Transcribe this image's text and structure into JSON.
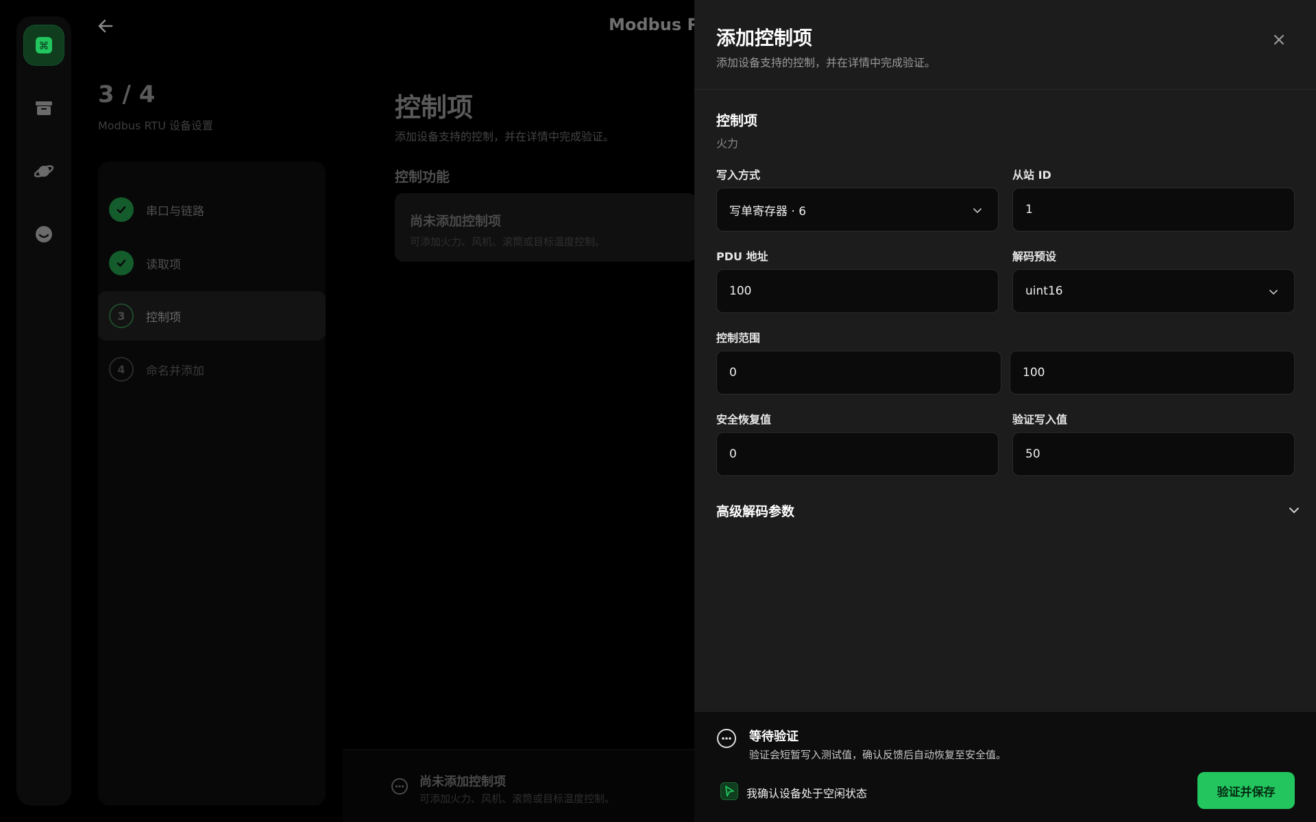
{
  "background": {
    "title": "Modbus R",
    "step_counter": "3 / 4",
    "step_subtitle": "Modbus RTU 设备设置",
    "steps": [
      {
        "label": "串口与链路",
        "state": "done"
      },
      {
        "label": "读取项",
        "state": "done"
      },
      {
        "label": "控制项",
        "state": "current",
        "number": "3"
      },
      {
        "label": "命名并添加",
        "state": "pending",
        "number": "4"
      }
    ],
    "heading": "控制项",
    "subheading": "添加设备支持的控制，并在详情中完成验证。",
    "section_title": "控制功能",
    "empty_card": {
      "title": "尚未添加控制项",
      "subtitle": "可添加火力、风机、滚筒或目标温度控制。"
    },
    "bottom": {
      "title": "尚未添加控制项",
      "subtitle": "可添加火力、风机、滚筒或目标温度控制。"
    }
  },
  "rail": {
    "items": [
      "command-icon",
      "archive-icon",
      "planet-icon",
      "smile-icon"
    ],
    "accent": "#22c55e"
  },
  "drawer": {
    "title": "添加控制项",
    "subtitle": "添加设备支持的控制，并在详情中完成验证。",
    "control_item": {
      "label": "控制项",
      "value": "火力"
    },
    "write_mode": {
      "label": "写入方式",
      "value": "写单寄存器 · 6"
    },
    "slave_id": {
      "label": "从站 ID",
      "value": "1"
    },
    "pdu_address": {
      "label": "PDU 地址",
      "value": "100"
    },
    "decode_preset": {
      "label": "解码预设",
      "value": "uint16"
    },
    "control_range": {
      "label": "控制范围",
      "min": "0",
      "max": "100"
    },
    "safe_value": {
      "label": "安全恢复值",
      "value": "0"
    },
    "verify_value": {
      "label": "验证写入值",
      "value": "50"
    },
    "advanced": {
      "label": "高级解码参数"
    },
    "footer": {
      "status_title": "等待验证",
      "status_desc": "验证会短暂写入测试值，确认反馈后自动恢复至安全值。",
      "confirm_label": "我确认设备处于空闲状态",
      "confirm_checked": true,
      "primary_button": "验证并保存"
    }
  }
}
